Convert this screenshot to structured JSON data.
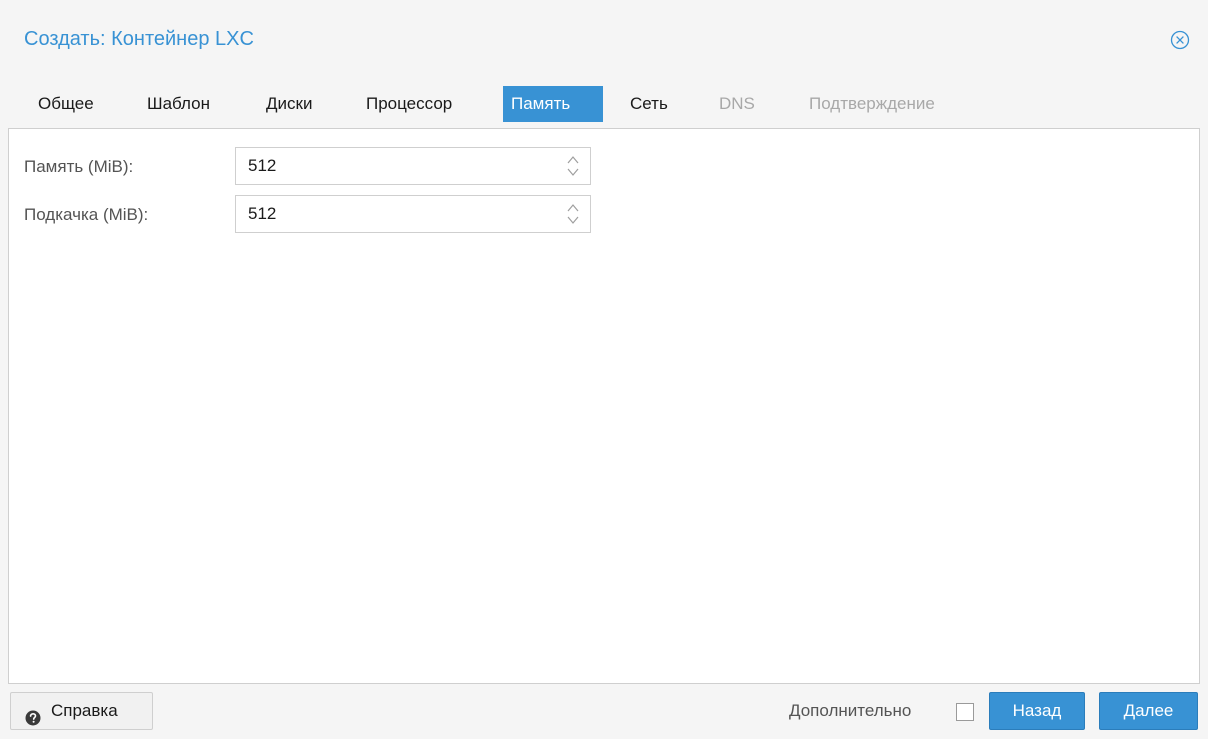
{
  "window": {
    "title": "Создать: Контейнер LXC"
  },
  "tabs": [
    {
      "label": "Общее",
      "state": "normal"
    },
    {
      "label": "Шаблон",
      "state": "normal"
    },
    {
      "label": "Диски",
      "state": "normal"
    },
    {
      "label": "Процессор",
      "state": "normal"
    },
    {
      "label": "Память",
      "state": "active"
    },
    {
      "label": "Сеть",
      "state": "normal"
    },
    {
      "label": "DNS",
      "state": "disabled"
    },
    {
      "label": "Подтверждение",
      "state": "disabled"
    }
  ],
  "form": {
    "memory": {
      "label": "Память (MiB):",
      "value": "512"
    },
    "swap": {
      "label": "Подкачка (MiB):",
      "value": "512"
    }
  },
  "footer": {
    "help_label": "Справка",
    "advanced_label": "Дополнительно",
    "advanced_checked": false,
    "back_label": "Назад",
    "next_label": "Далее"
  },
  "colors": {
    "accent": "#3892d4",
    "background": "#f5f5f5",
    "disabled_text": "#a8a8a8"
  },
  "icons": {
    "close": "close-circle-icon",
    "help": "question-circle-icon",
    "spinner": "spinner-arrows-icon"
  }
}
